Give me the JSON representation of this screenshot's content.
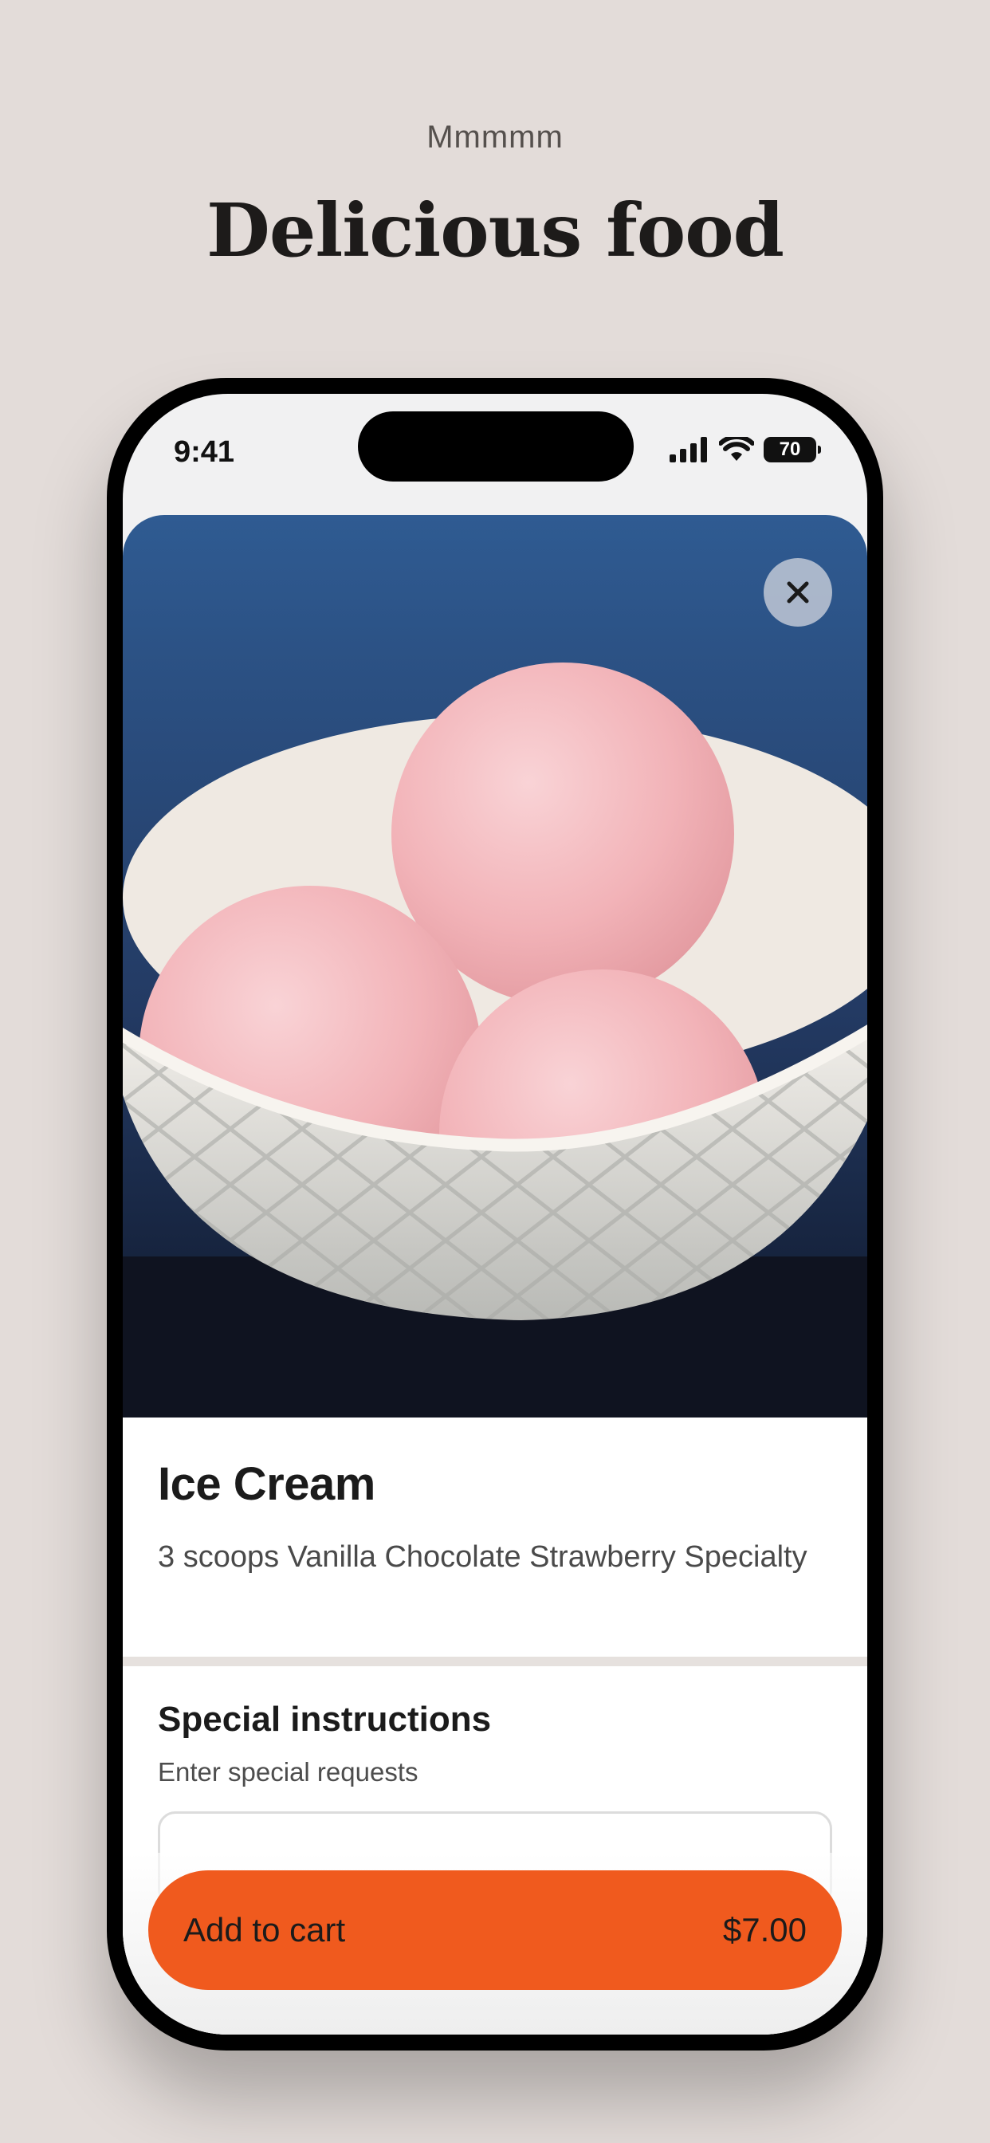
{
  "page": {
    "eyebrow": "Mmmmm",
    "headline": "Delicious food"
  },
  "status_bar": {
    "time": "9:41",
    "battery_level": "70",
    "icons": [
      "signal-icon",
      "wifi-icon",
      "battery-icon"
    ]
  },
  "item": {
    "image_subject": "ice-cream-bowl",
    "name": "Ice Cream",
    "description": "3 scoops Vanilla Chocolate Strawberry Specialty"
  },
  "special_instructions": {
    "title": "Special instructions",
    "subtitle": "Enter special requests",
    "value": ""
  },
  "cart": {
    "label": "Add to cart",
    "price": "$7.00"
  },
  "colors": {
    "background": "#e3dcd9",
    "accent": "#f05a1e"
  }
}
